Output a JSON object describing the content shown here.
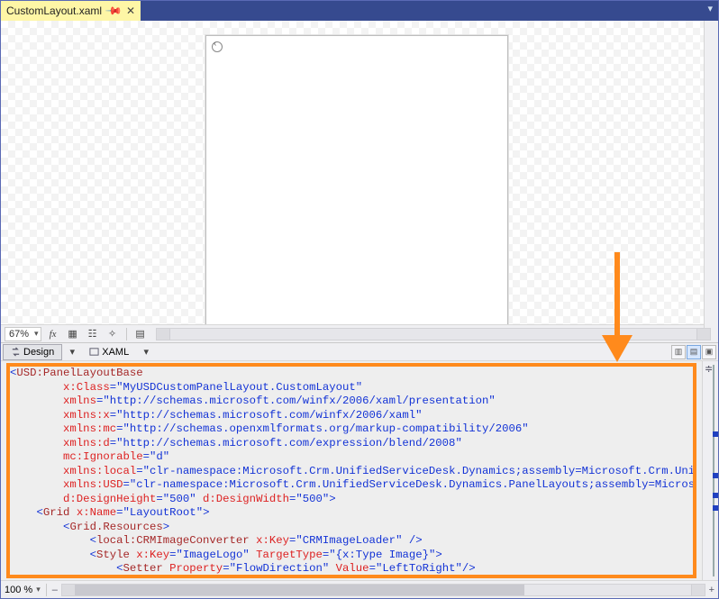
{
  "tabstrip": {
    "file_label": "CustomLayout.xaml"
  },
  "designer": {
    "zoom_label": "67%"
  },
  "splitter": {
    "design_tab": "Design",
    "xaml_tab": "XAML"
  },
  "statusbar": {
    "zoom_label": "100 %"
  },
  "code": {
    "lines": [
      [
        [
          "t-pun",
          "<"
        ],
        [
          "t-elm",
          "USD:PanelLayoutBase"
        ]
      ],
      [
        [
          "t-tx",
          "        "
        ],
        [
          "t-attr",
          "x:Class"
        ],
        [
          "t-pun",
          "=\""
        ],
        [
          "t-str",
          "MyUSDCustomPanelLayout.CustomLayout"
        ],
        [
          "t-pun",
          "\""
        ]
      ],
      [
        [
          "t-tx",
          "        "
        ],
        [
          "t-attr",
          "xmlns"
        ],
        [
          "t-pun",
          "=\""
        ],
        [
          "t-str",
          "http://schemas.microsoft.com/winfx/2006/xaml/presentation"
        ],
        [
          "t-pun",
          "\""
        ]
      ],
      [
        [
          "t-tx",
          "        "
        ],
        [
          "t-attr",
          "xmlns:x"
        ],
        [
          "t-pun",
          "=\""
        ],
        [
          "t-str",
          "http://schemas.microsoft.com/winfx/2006/xaml"
        ],
        [
          "t-pun",
          "\""
        ]
      ],
      [
        [
          "t-tx",
          "        "
        ],
        [
          "t-attr",
          "xmlns:mc"
        ],
        [
          "t-pun",
          "=\""
        ],
        [
          "t-str",
          "http://schemas.openxmlformats.org/markup-compatibility/2006"
        ],
        [
          "t-pun",
          "\""
        ]
      ],
      [
        [
          "t-tx",
          "        "
        ],
        [
          "t-attr",
          "xmlns:d"
        ],
        [
          "t-pun",
          "=\""
        ],
        [
          "t-str",
          "http://schemas.microsoft.com/expression/blend/2008"
        ],
        [
          "t-pun",
          "\""
        ]
      ],
      [
        [
          "t-tx",
          "        "
        ],
        [
          "t-attr",
          "mc:Ignorable"
        ],
        [
          "t-pun",
          "=\""
        ],
        [
          "t-str",
          "d"
        ],
        [
          "t-pun",
          "\""
        ]
      ],
      [
        [
          "t-tx",
          "        "
        ],
        [
          "t-attr",
          "xmlns:local"
        ],
        [
          "t-pun",
          "=\""
        ],
        [
          "t-str",
          "clr-namespace:Microsoft.Crm.UnifiedServiceDesk.Dynamics;assembly=Microsoft.Crm.Unifi"
        ]
      ],
      [
        [
          "t-tx",
          "        "
        ],
        [
          "t-attr",
          "xmlns:USD"
        ],
        [
          "t-pun",
          "=\""
        ],
        [
          "t-str",
          "clr-namespace:Microsoft.Crm.UnifiedServiceDesk.Dynamics.PanelLayouts;assembly=Microsof"
        ]
      ],
      [
        [
          "t-tx",
          "        "
        ],
        [
          "t-attr",
          "d:DesignHeight"
        ],
        [
          "t-pun",
          "=\""
        ],
        [
          "t-str",
          "500"
        ],
        [
          "t-pun",
          "\" "
        ],
        [
          "t-attr",
          "d:DesignWidth"
        ],
        [
          "t-pun",
          "=\""
        ],
        [
          "t-str",
          "500"
        ],
        [
          "t-pun",
          "\">"
        ]
      ],
      [
        [
          "t-tx",
          "    "
        ],
        [
          "t-pun",
          "<"
        ],
        [
          "t-elm",
          "Grid"
        ],
        [
          "t-tx",
          " "
        ],
        [
          "t-attr",
          "x:Name"
        ],
        [
          "t-pun",
          "=\""
        ],
        [
          "t-str",
          "LayoutRoot"
        ],
        [
          "t-pun",
          "\">"
        ]
      ],
      [
        [
          "t-tx",
          "        "
        ],
        [
          "t-pun",
          "<"
        ],
        [
          "t-elm",
          "Grid.Resources"
        ],
        [
          "t-pun",
          ">"
        ]
      ],
      [
        [
          "t-tx",
          "            "
        ],
        [
          "t-pun",
          "<"
        ],
        [
          "t-elm",
          "local:CRMImageConverter"
        ],
        [
          "t-tx",
          " "
        ],
        [
          "t-attr",
          "x:Key"
        ],
        [
          "t-pun",
          "=\""
        ],
        [
          "t-str",
          "CRMImageLoader"
        ],
        [
          "t-pun",
          "\" />"
        ]
      ],
      [
        [
          "t-tx",
          "            "
        ],
        [
          "t-pun",
          "<"
        ],
        [
          "t-elm",
          "Style"
        ],
        [
          "t-tx",
          " "
        ],
        [
          "t-attr",
          "x:Key"
        ],
        [
          "t-pun",
          "=\""
        ],
        [
          "t-str",
          "ImageLogo"
        ],
        [
          "t-pun",
          "\" "
        ],
        [
          "t-attr",
          "TargetType"
        ],
        [
          "t-pun",
          "=\""
        ],
        [
          "t-str",
          "{x:Type Image}"
        ],
        [
          "t-pun",
          "\">"
        ]
      ],
      [
        [
          "t-tx",
          "                "
        ],
        [
          "t-pun",
          "<"
        ],
        [
          "t-elm",
          "Setter"
        ],
        [
          "t-tx",
          " "
        ],
        [
          "t-attr",
          "Property"
        ],
        [
          "t-pun",
          "=\""
        ],
        [
          "t-str",
          "FlowDirection"
        ],
        [
          "t-pun",
          "\" "
        ],
        [
          "t-attr",
          "Value"
        ],
        [
          "t-pun",
          "=\""
        ],
        [
          "t-str",
          "LeftToRight"
        ],
        [
          "t-pun",
          "\"/>"
        ]
      ]
    ]
  }
}
